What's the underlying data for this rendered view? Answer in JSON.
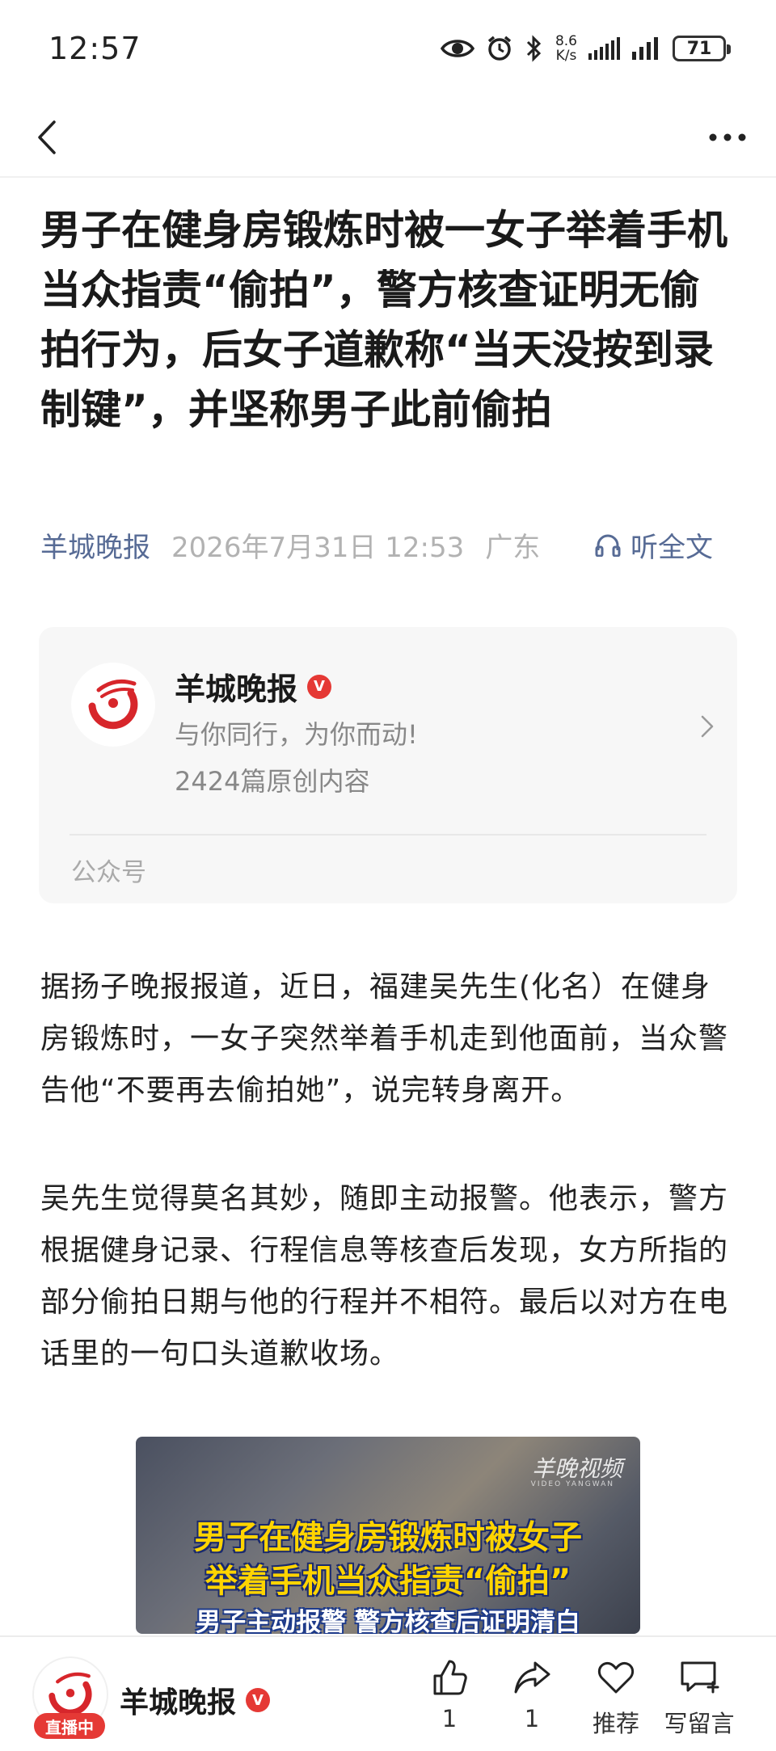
{
  "status_bar": {
    "time": "12:57",
    "net_speed_value": "8.6",
    "net_speed_unit": "K/s",
    "battery": "71",
    "icons": [
      "eye-icon",
      "alarm-icon",
      "bluetooth-icon",
      "signal-icon",
      "signal-icon",
      "battery-icon"
    ]
  },
  "nav": {
    "back_icon": "chevron-left-icon",
    "more_icon": "more-horizontal-icon"
  },
  "article": {
    "title": "男子在健身房锻炼时被一女子举着手机当众指责“偷拍”，警方核查证明无偷拍行为，后女子道歉称“当天没按到录制键”，并坚称男子此前偷拍",
    "source": "羊城晚报",
    "date": "2026年7月31日 12:53",
    "region": "广东",
    "listen_label": "听全文",
    "paragraphs": [
      "据扬子晚报报道，近日，福建吴先生(化名）在健身房锻炼时，一女子突然举着手机走到他面前，当众警告他“不要再去偷拍她”，说完转身离开。",
      "吴先生觉得莫名其妙，随即主动报警。他表示，警方根据健身记录、行程信息等核查后发现，女方所指的部分偷拍日期与他的行程并不相符。最后以对方在电话里的一句口头道歉收场。"
    ]
  },
  "account_card": {
    "logo_text": "羊城晚报",
    "name": "羊城晚报",
    "verified": "V",
    "slogan": "与你同行，为你而动!",
    "original_count": "2424篇原创内容",
    "type_label": "公众号"
  },
  "video": {
    "watermark": "羊晚视频",
    "watermark_sub": "VIDEO YANGWAN",
    "line1": "男子在健身房锻炼时被女子",
    "line2": "举着手机当众指责“偷拍”",
    "line3": "男子主动报警 警方核查后证明清白"
  },
  "bottom_bar": {
    "live_label": "直播中",
    "name": "羊城晚报",
    "verified": "V",
    "like_count": "1",
    "share_count": "1",
    "recommend_label": "推荐",
    "comment_label": "写留言"
  },
  "colors": {
    "link": "#576b95",
    "muted": "#b2b2b2",
    "brand_red": "#e53935",
    "card_bg": "#f7f7f7"
  }
}
